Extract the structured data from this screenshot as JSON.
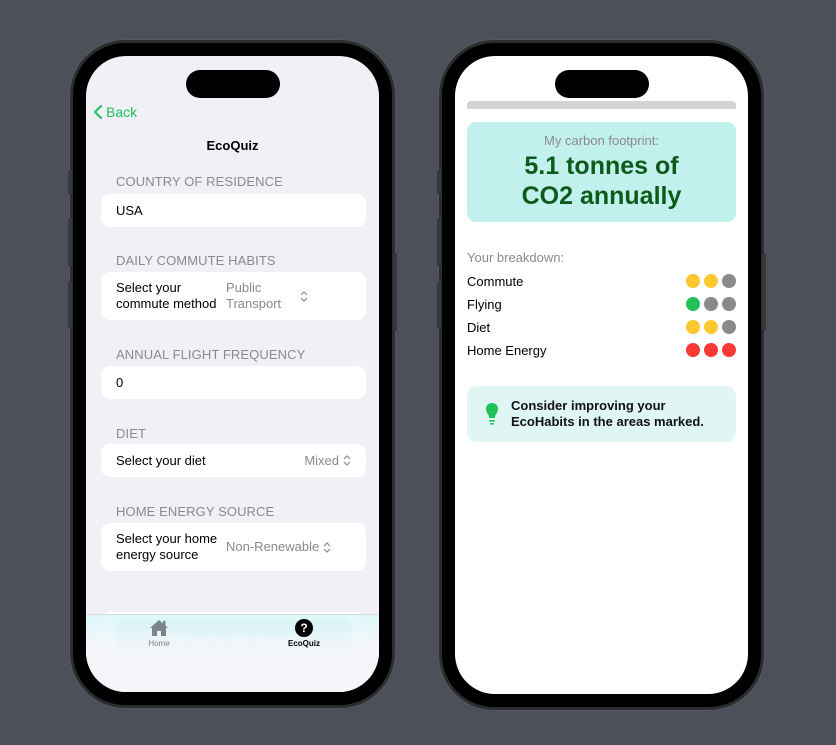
{
  "colors": {
    "accent_green": "#22c05a",
    "calc_button": "#19c0b2",
    "footprint_card": "#c2f0ed",
    "footprint_text": "#0e5a1a",
    "tip_card": "#dff6f5",
    "level_yellow": "#fdc72e",
    "level_gray": "#8a8a8e",
    "level_green": "#1fc257",
    "level_red": "#fc3a35"
  },
  "quiz_screen": {
    "back_label": "Back",
    "back_icon": "chevron-left-icon",
    "title": "EcoQuiz",
    "sections": {
      "country": {
        "header": "COUNTRY OF RESIDENCE",
        "value": "USA"
      },
      "commute": {
        "header": "DAILY COMMUTE HABITS",
        "label": "Select your commute method",
        "value": "Public Transport"
      },
      "flights": {
        "header": "ANNUAL FLIGHT FREQUENCY",
        "value": "0"
      },
      "diet": {
        "header": "DIET",
        "label": "Select your diet",
        "value": "Mixed"
      },
      "energy": {
        "header": "HOME ENERGY SOURCE",
        "label": "Select your home energy source",
        "value": "Non-Renewable"
      }
    },
    "calculate_label": "Calculate Footprint",
    "tabbar": {
      "tabs": [
        {
          "label": "Home",
          "icon": "house-icon",
          "selected": false
        },
        {
          "label": "EcoQuiz",
          "icon": "question-circle-icon",
          "icon_glyph": "?",
          "selected": true
        }
      ]
    }
  },
  "result_screen": {
    "footprint_label": "My carbon footprint:",
    "footprint_value": "5.1 tonnes of CO2 annually",
    "breakdown_label": "Your breakdown:",
    "breakdown": [
      {
        "name": "Commute",
        "dots": [
          "yellow",
          "yellow",
          "gray"
        ]
      },
      {
        "name": "Flying",
        "dots": [
          "green",
          "gray",
          "gray"
        ]
      },
      {
        "name": "Diet",
        "dots": [
          "yellow",
          "yellow",
          "gray"
        ]
      },
      {
        "name": "Home Energy",
        "dots": [
          "red",
          "red",
          "red"
        ]
      }
    ],
    "tip_icon": "lightbulb-icon",
    "tip_text": "Consider improving your EcoHabits in the areas marked."
  }
}
